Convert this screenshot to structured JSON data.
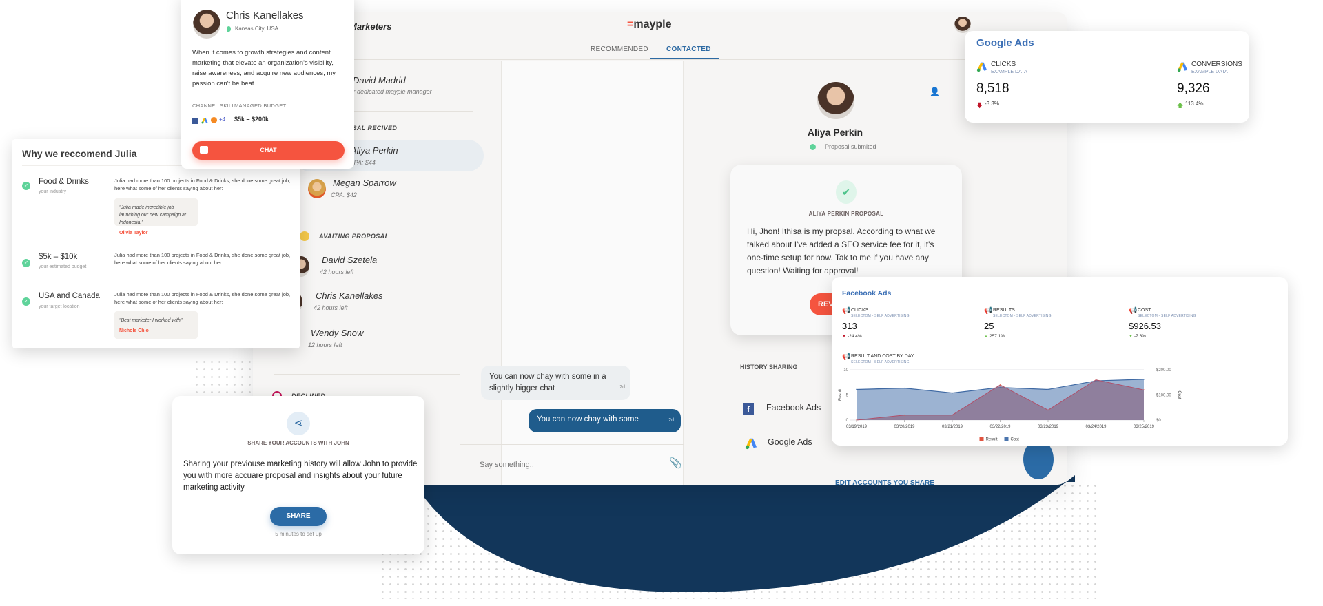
{
  "main": {
    "header_title": "Marketers",
    "logo": "mayple",
    "tabs": [
      {
        "label": "RECOMMENDED",
        "active": false
      },
      {
        "label": "CONTACTED",
        "active": true
      }
    ],
    "manager": {
      "name": "David Madrid",
      "subtitle": "Your dedicated mayple manager"
    },
    "sections": {
      "received": "PROPOSAL RECIVED",
      "awaiting": "AVAITING PROPOSAL",
      "declined": "DECLINED"
    },
    "received": [
      {
        "name": "Aliya Perkin",
        "meta": "CPA: $44"
      },
      {
        "name": "Megan Sparrow",
        "meta": "CPA: $42"
      }
    ],
    "awaiting": [
      {
        "name": "David Szetela",
        "meta": "42 hours left"
      },
      {
        "name": "Chris Kanellakes",
        "meta": "42 hours left"
      },
      {
        "name": "Wendy Snow",
        "meta": "12 hours left"
      }
    ],
    "chat": {
      "messages": [
        {
          "text": "You can now chay with some in a slightly bigger chat",
          "time": "2d"
        },
        {
          "text": "You can now chay with some",
          "time": "2d"
        }
      ],
      "placeholder": "Say something.."
    },
    "profile": {
      "name": "Aliya Perkin",
      "status": "Proposal submited",
      "proposal_title": "ALIYA PERKIN PROPOSAL",
      "proposal_text": "Hi, Jhon! Ithisa is my propsal. According to what we talked about I've added a SEO service fee for it, it's one-time setup for now. Tak to me if you have any question! Waiting for approval!",
      "review_button": "REVIEW",
      "history_title": "HISTORY SHARING",
      "accounts": [
        "Facebook Ads",
        "Google Ads"
      ],
      "edit_link": "EDIT ACCOUNTS YOU SHARE"
    }
  },
  "chris_card": {
    "name": "Chris Kanellakes",
    "location": "Kansas City, USA",
    "bio": "When it comes to growth strategies and content marketing that elevate an organization's visibility, raise awareness, and acquire new audiences, my passion can't be beat.",
    "channel_label": "CHANNEL SKILL",
    "channel_more": "+4",
    "budget_label": "MANAGED BUDGET",
    "budget_value": "$5k – $200k",
    "chat_button": "CHAT"
  },
  "julia_card": {
    "title": "Why we reccomend Julia",
    "items": [
      {
        "title": "Food & Drinks",
        "subtitle": "your industry",
        "desc": "Julia had more than 100 projects in Food & Drinks, she done some great job, here what some of her clients saying about her:",
        "quote": "\"Julia made incredible job launching our new campaign at Indonesia.\"",
        "author": "Olivia Taylor"
      },
      {
        "title": "$5k – $10k",
        "subtitle": "your estimated budget",
        "desc": "Julia had more than 100 projects in Food & Drinks, she done some great job, here what some of her clients saying about her:"
      },
      {
        "title": "USA and Canada",
        "subtitle": "your target location",
        "desc": "Julia had more than 100 projects in Food & Drinks, she done some great job, here what some of her clients saying about her:",
        "quote": "\"Best marketer I worked with\"",
        "author": "Nichole Chlo"
      }
    ]
  },
  "share_card": {
    "title": "SHARE YOUR ACCOUNTS WITH JOHN",
    "body": "Sharing your previouse marketing history will allow John to provide you with more accuare proposal and insights about your future marketing activity",
    "button": "SHARE",
    "note": "5 minutes to set up"
  },
  "google_ads": {
    "title": "Google Ads",
    "metrics": [
      {
        "label": "CLICKS",
        "sub": "EXAMPLE DATA",
        "value": "8,518",
        "change": "-3.3%",
        "dir": "down"
      },
      {
        "label": "CONVERSIONS",
        "sub": "EXAMPLE DATA",
        "value": "9,326",
        "change": "113.4%",
        "dir": "up"
      }
    ]
  },
  "facebook_ads": {
    "title": "Facebook Ads",
    "metrics": [
      {
        "label": "CLICKS",
        "sub": "SELECTOM - SELF ADVERTISING",
        "value": "313",
        "change": "-24.4%",
        "dir": "down"
      },
      {
        "label": "RESULTS",
        "sub": "SELECTOM - SELF ADVERTISING",
        "value": "25",
        "change": "257.1%",
        "dir": "up"
      },
      {
        "label": "COST",
        "sub": "SELECTOM - SELF ADVERTISING",
        "value": "$926.53",
        "change": "-7.6%",
        "dir": "down-good"
      }
    ],
    "chart_title": "RESULT AND COST BY DAY",
    "chart_sub": "SELECTOM - SELF ADVERTISING"
  },
  "chart_data": {
    "type": "area",
    "title": "RESULT AND COST BY DAY",
    "categories": [
      "03/19/2019",
      "03/20/2019",
      "03/21/2019",
      "03/22/2019",
      "03/23/2019",
      "03/24/2019",
      "03/25/2019"
    ],
    "series": [
      {
        "name": "Result",
        "axis": "left",
        "color": "#e0533f",
        "values": [
          0,
          1,
          1,
          7,
          2,
          8,
          6
        ]
      },
      {
        "name": "Cost",
        "axis": "right",
        "color": "#4a74ad",
        "values": [
          122,
          127,
          108,
          130,
          122,
          156,
          162
        ]
      }
    ],
    "ylabel": "Result",
    "ylim": [
      0,
      10
    ],
    "yticks": [
      "0",
      "5",
      "10"
    ],
    "y2label": "Cost",
    "y2lim": [
      0,
      200
    ],
    "y2ticks": [
      "$0",
      "$100.00",
      "$200.00"
    ],
    "legend": "bottom",
    "grid": true
  },
  "colors": {
    "accent": "#f5543f",
    "brand_blue": "#1f5c8c",
    "title_blue": "#3b6fb5",
    "navy": "#12365a"
  }
}
